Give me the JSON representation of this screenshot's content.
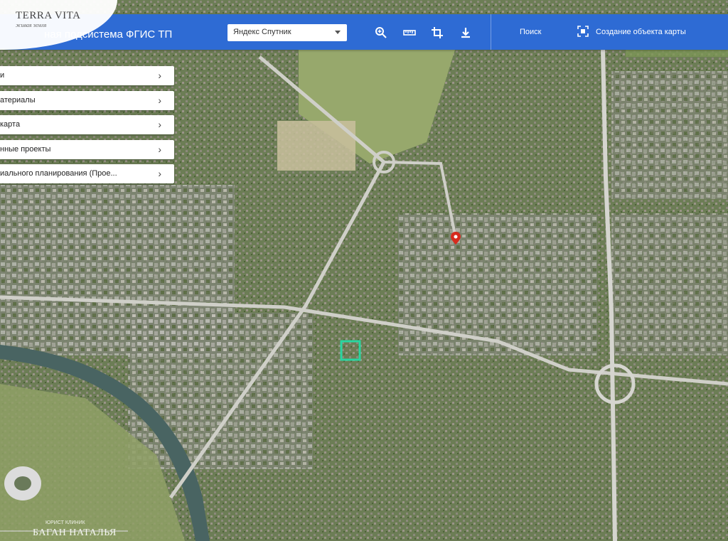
{
  "header": {
    "title": "ная подсистема ФГИС ТП",
    "basemap_select": {
      "value": "Яндекс Спутник"
    },
    "tools": [
      "zoom-in-icon",
      "ruler-icon",
      "crop-icon",
      "download-icon"
    ],
    "search_label": "Поиск",
    "create_object_label": "Создание объекта карты",
    "color": "#2e6bd4"
  },
  "logo": {
    "title": "TERRA VITA",
    "subtitle": "живая земля"
  },
  "sidebar": {
    "items": [
      {
        "label": "и"
      },
      {
        "label": "атериалы"
      },
      {
        "label": "карта"
      },
      {
        "label": "нные проекты"
      },
      {
        "label": "иального планирования (Прое..."
      }
    ]
  },
  "watermark": {
    "line1": "ЮРИСТ КЛИНИК",
    "line2": "БАГАН НАТАЛЬЯ"
  }
}
